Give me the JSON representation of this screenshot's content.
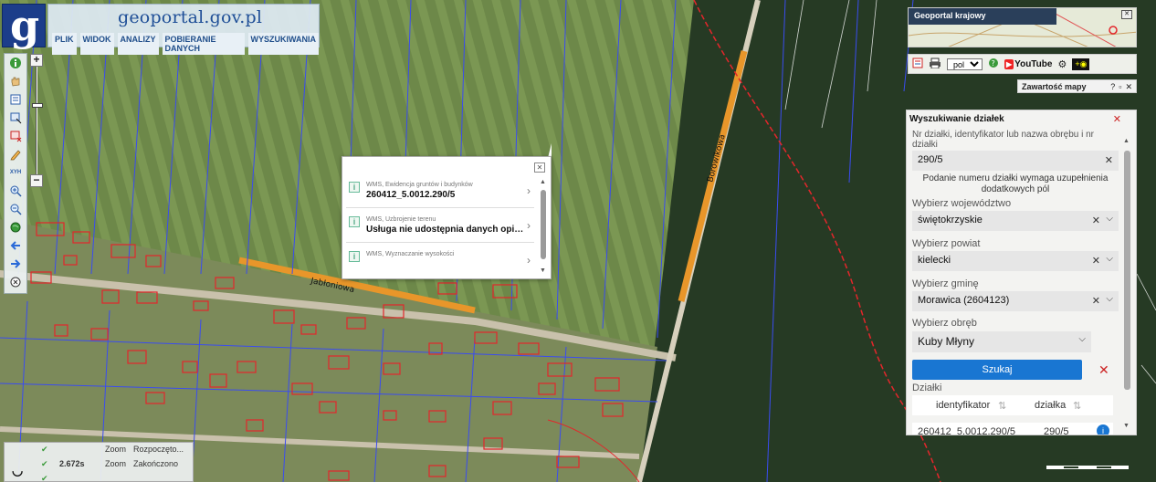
{
  "header": {
    "site_title": "geoportal.gov.pl",
    "logo_letter": "g",
    "menu": [
      "PLIK",
      "WIDOK",
      "ANALIZY",
      "POBIERANIE DANYCH",
      "WYSZUKIWANIA"
    ]
  },
  "toolbar": {
    "tools": [
      "info-icon",
      "pan-hand-icon",
      "layers-list-icon",
      "select-area-icon",
      "remove-selection-icon",
      "pencil-icon",
      "xyz-coordinates-icon",
      "zoom-in-tool-icon",
      "zoom-out-tool-icon",
      "full-extent-icon",
      "back-arrow-icon",
      "forward-arrow-icon",
      "close-circle-icon"
    ],
    "xyz_label": "XYH",
    "zoom_in": "+",
    "zoom_out": "−"
  },
  "popup": {
    "close_label": "✕",
    "items": [
      {
        "source": "WMS, Ewidencja gruntów i budynków",
        "value": "260412_5.0012.290/5"
      },
      {
        "source": "WMS, Uzbrojenie terenu",
        "value": "Usługa nie udostępnia danych opi…"
      },
      {
        "source": "WMS, Wyznaczanie wysokości",
        "value": ""
      }
    ]
  },
  "map": {
    "street_labels": [
      "Jabłoniowa",
      "Borowikowa"
    ]
  },
  "minimap": {
    "title": "Geoportal krajowy"
  },
  "iconbar": {
    "language": "pol",
    "youtube": "YouTube"
  },
  "contents": {
    "title": "Zawartość mapy",
    "controls": [
      "?",
      "▫",
      "✕"
    ]
  },
  "search_panel": {
    "title": "Wyszukiwanie działek",
    "close": "✕",
    "query_label": "Nr działki, identyfikator lub nazwa obrębu i nr działki",
    "query_value": "290/5",
    "note": "Podanie numeru działki wymaga uzupełnienia dodatkowych pól",
    "voivodeship_label": "Wybierz województwo",
    "voivodeship_value": "świętokrzyskie",
    "county_label": "Wybierz powiat",
    "county_value": "kielecki",
    "commune_label": "Wybierz gminę",
    "commune_value": "Morawica (2604123)",
    "precinct_label": "Wybierz obręb",
    "precinct_value": "Kuby Młyny",
    "search_button": "Szukaj",
    "results_label": "Działki",
    "columns": [
      "identyfikator",
      "działka"
    ],
    "rows": [
      {
        "identyfikator": "260412_5.0012.290/5",
        "dzialka": "290/5"
      }
    ]
  },
  "status": {
    "rows": [
      {
        "time": "",
        "type": "Zoom",
        "state": "Rozpoczęto..."
      },
      {
        "time": "2.672s",
        "type": "Zoom",
        "state": "Zakończono"
      }
    ]
  },
  "colors": {
    "accent": "#1976d2",
    "parcel": "#e3262b",
    "boundary": "#3a4cf0",
    "highlight": "#e8962a"
  }
}
